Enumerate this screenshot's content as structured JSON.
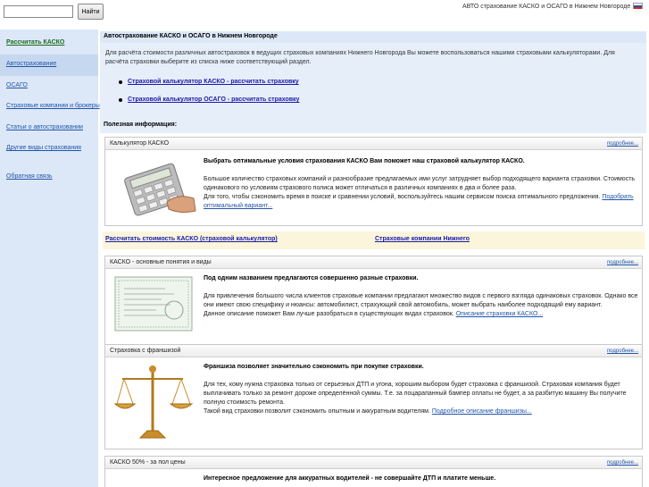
{
  "header": {
    "search_placeholder": "",
    "search_button": "Найти",
    "site_title": "АВТО страхование КАСКО и ОСАГО в Нижнем Новгороде"
  },
  "sidebar": {
    "items": [
      {
        "label": "Рассчитать КАСКО"
      },
      {
        "label": "Автострахование"
      },
      {
        "label": "ОСАГО"
      },
      {
        "label": "Страховые компании и брокеры"
      },
      {
        "label": "Статьи о автостраховании"
      },
      {
        "label": "Другие виды страхования"
      },
      {
        "label": "Обратная связь"
      }
    ]
  },
  "main": {
    "page_heading": "Автострахование КАСКО и ОСАГО в Нижнем Новгороде",
    "intro_text": "Для расчёта стоимости различных автостраховок в ведущих страховых компаниях Нижнего Новгорода Вы можете воспользоваться нашими страховыми калькуляторами. Для расчёта страховки выберите из списка ниже соответствующий раздел.",
    "intro_links": [
      "Страховой калькулятор КАСКО - рассчитать страховку",
      "Страховой калькулятор ОСАГО - рассчитать страховку"
    ],
    "useful_heading": "Полезная информация:",
    "more_label": "подробнее...",
    "cards": [
      {
        "title": "Калькулятор КАСКО",
        "lead": "Выбрать оптимальные условия страхования КАСКО Вам поможет наш страховой калькулятор КАСКО.",
        "body": "Большое количество страховых компаний и разнообразие предлагаемых ими услуг затрудняет выбор подходящего варианта страховки. Стоимость одинакового по условиям страхового полиса может отличаться в различных компаниях в два и более раза.",
        "body2": "Для того, чтобы сэкономить время в поиске и сравнении условий, воспользуйтесь нашим сервисом поиска оптимального предложения.",
        "link": "Подобрать оптимальный вариант..."
      },
      {
        "title": "КАСКО - основные понятия и виды",
        "lead": "Под одним названием предлагаются совершенно разные страховки.",
        "body": "Для привлечения большого числа клиентов страховые компании предлагают множество видов с первого взгляда одинаковых страховок. Однако все они имеют свою специфику и нюансы: автомобилист, страхующий свой автомобиль, может выбрать наиболее подходящий ему вариант.",
        "body2": "Данное описание поможет Вам лучше разобраться в существующих видах страховок.",
        "link": "Описание страховки КАСКО..."
      },
      {
        "title": "Страховка с франшизой",
        "lead": "Франшиза позволяет значительно сэкономить при покупке страховки.",
        "body": "Для тех, кому нужна страховка только от серьезных ДТП и угона, хорошим выбором будет страховка с франшизой. Страховая компания будет выплачивать только за ремонт дороже определённой суммы. Т.е. за поцарапанный бампер оплаты не будет, а за разбитую машину Вы получите полную стоимость ремонта.",
        "body2": "Такой вид страховки позволит сэкономить опытным и аккуратным водителям.",
        "link": "Подробное описание франшизы..."
      },
      {
        "title": "КАСКО 50% - за пол цены",
        "lead": "Интересное предложение для аккуратных водителей - не совершайте ДТП и платите меньше."
      }
    ],
    "link_bar": [
      "Рассчитать стоимость КАСКО (страховой калькулятор)",
      "Страховые компании Нижнего"
    ]
  },
  "icons": [
    "calculator-image",
    "insurance-certificate-image",
    "scales-image",
    "russian-flag-icon"
  ]
}
